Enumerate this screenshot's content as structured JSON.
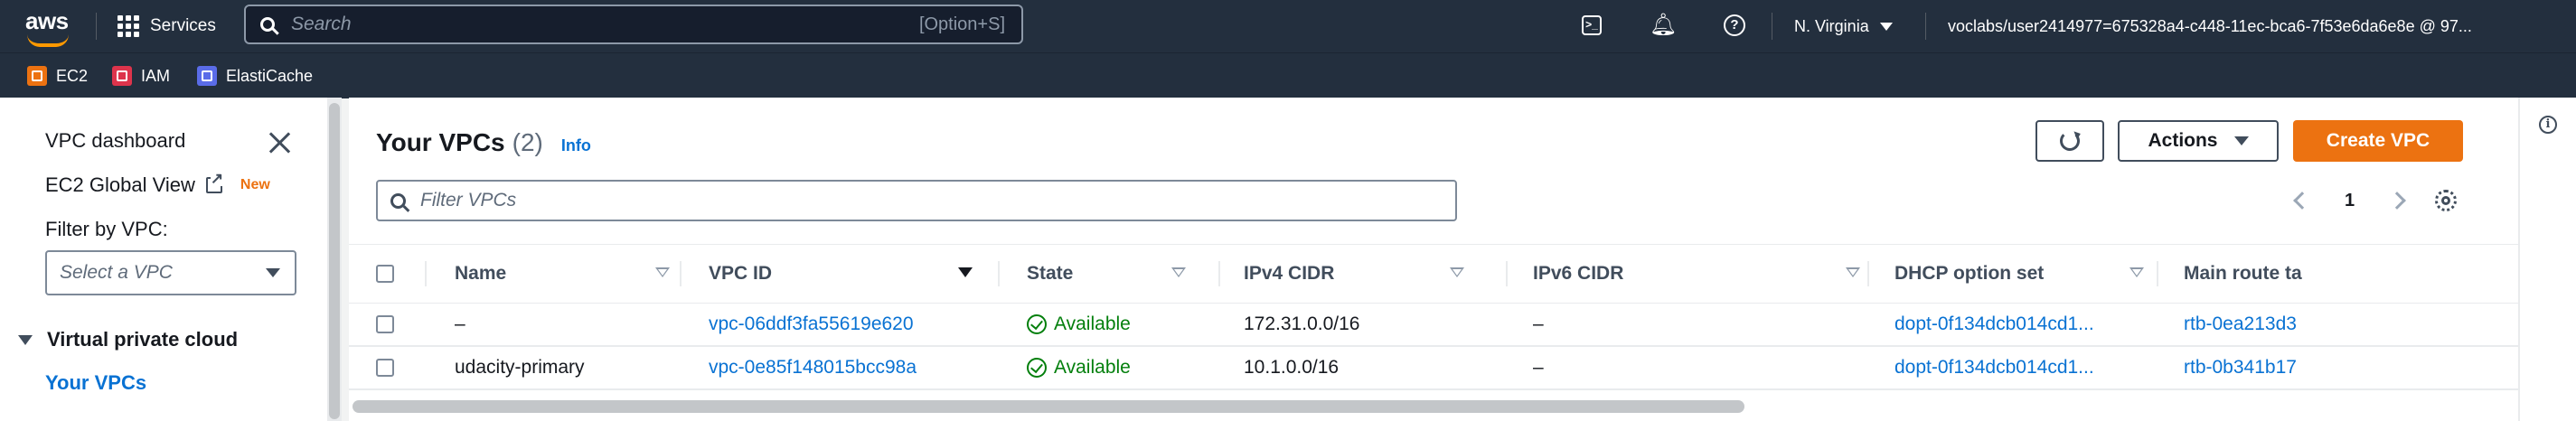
{
  "topnav": {
    "logo": "aws",
    "services_label": "Services",
    "search_placeholder": "Search",
    "search_shortcut": "[Option+S]",
    "region": "N. Virginia",
    "account": "voclabs/user2414977=675328a4-c448-11ec-bca6-7f53e6da6e8e @ 97..."
  },
  "favorites": [
    {
      "label": "EC2",
      "icon": "ec2-icon",
      "color": "#ec7211"
    },
    {
      "label": "IAM",
      "icon": "iam-icon",
      "color": "#dd344c"
    },
    {
      "label": "ElastiCache",
      "icon": "elasticache-icon",
      "color": "#5a6ce8"
    }
  ],
  "sidebar": {
    "title": "VPC dashboard",
    "global_view": "EC2 Global View",
    "new_badge": "New",
    "filter_label": "Filter by VPC:",
    "filter_placeholder": "Select a VPC",
    "section": "Virtual private cloud",
    "active_item": "Your VPCs"
  },
  "main": {
    "title": "Your VPCs",
    "count": "(2)",
    "info": "Info",
    "actions_label": "Actions",
    "create_label": "Create VPC",
    "filter_placeholder": "Filter VPCs",
    "page": "1",
    "columns": [
      "Name",
      "VPC ID",
      "State",
      "IPv4 CIDR",
      "IPv6 CIDR",
      "DHCP option set",
      "Main route ta"
    ],
    "rows": [
      {
        "name": "–",
        "vpc_id": "vpc-06ddf3fa55619e620",
        "state": "Available",
        "ipv4": "172.31.0.0/16",
        "ipv6": "–",
        "dhcp": "dopt-0f134dcb014cd1...",
        "route": "rtb-0ea213d3"
      },
      {
        "name": "udacity-primary",
        "vpc_id": "vpc-0e85f148015bcc98a",
        "state": "Available",
        "ipv4": "10.1.0.0/16",
        "ipv6": "–",
        "dhcp": "dopt-0f134dcb014cd1...",
        "route": "rtb-0b341b17"
      }
    ]
  },
  "colors": {
    "nav_bg": "#232f3e",
    "accent": "#ec7211",
    "link": "#0972d3",
    "success": "#037f0c"
  }
}
